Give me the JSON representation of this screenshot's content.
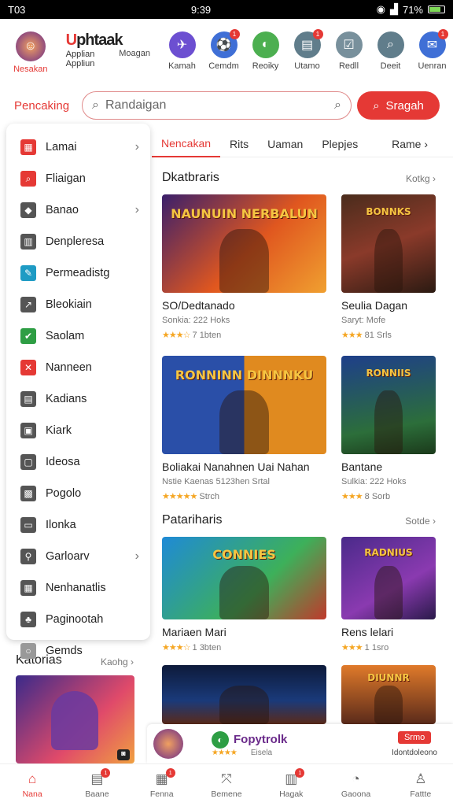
{
  "status": {
    "time_left": "T03",
    "time_center": "9:39",
    "battery": "71%"
  },
  "top_nav": {
    "profile_label": "Nesakan",
    "logo_text_1": "U",
    "logo_text_2": "phtaak",
    "logo_sub_1": "Applian",
    "logo_sub_2": "Appliun",
    "logo_side": "Moagan",
    "items": [
      {
        "label": "Kamah",
        "color": "#6c4fd1",
        "glyph": "✈",
        "badge": ""
      },
      {
        "label": "Cemdm",
        "color": "#3f6fd6",
        "glyph": "⚽",
        "badge": "1"
      },
      {
        "label": "Reoiky",
        "color": "#4caf50",
        "glyph": "◐",
        "badge": ""
      },
      {
        "label": "Utamo",
        "color": "#607d8b",
        "glyph": "▤",
        "badge": "1"
      },
      {
        "label": "Redll",
        "color": "#78909c",
        "glyph": "☑",
        "badge": ""
      },
      {
        "label": "Deeit",
        "color": "#607d8b",
        "glyph": "⌕",
        "badge": ""
      },
      {
        "label": "Uenran",
        "color": "#3f6fd6",
        "glyph": "✉",
        "badge": "1"
      }
    ]
  },
  "search": {
    "label": "Pencaking",
    "placeholder": "Randaigan",
    "button": "Sragah"
  },
  "drawer": [
    {
      "label": "Lamai",
      "color": "#e53935",
      "glyph": "▦",
      "chev": "›"
    },
    {
      "label": "Fliaigan",
      "color": "#e53935",
      "glyph": "⌕",
      "chev": ""
    },
    {
      "label": "Banao",
      "color": "#555",
      "glyph": "◆",
      "chev": "›"
    },
    {
      "label": "Denpleresa",
      "color": "#555",
      "glyph": "▥",
      "chev": ""
    },
    {
      "label": "Permeadistg",
      "color": "#1e9bc4",
      "glyph": "✎",
      "chev": ""
    },
    {
      "label": "Bleokiain",
      "color": "#555",
      "glyph": "↗",
      "chev": ""
    },
    {
      "label": "Saolam",
      "color": "#2e9e44",
      "glyph": "✔",
      "chev": ""
    },
    {
      "label": "Nanneen",
      "color": "#e53935",
      "glyph": "✕",
      "chev": ""
    },
    {
      "label": "Kadians",
      "color": "#555",
      "glyph": "▤",
      "chev": ""
    },
    {
      "label": "Kiark",
      "color": "#555",
      "glyph": "▣",
      "chev": ""
    },
    {
      "label": "Ideosa",
      "color": "#555",
      "glyph": "▢",
      "chev": ""
    },
    {
      "label": "Pogolo",
      "color": "#555",
      "glyph": "▩",
      "chev": ""
    },
    {
      "label": "Ilonka",
      "color": "#555",
      "glyph": "▭",
      "chev": ""
    },
    {
      "label": "Garloarv",
      "color": "#555",
      "glyph": "⚲",
      "chev": "›"
    },
    {
      "label": "Nenhanatlis",
      "color": "#555",
      "glyph": "▦",
      "chev": ""
    },
    {
      "label": "Paginootah",
      "color": "#555",
      "glyph": "♣",
      "chev": ""
    },
    {
      "label": "Gemds",
      "color": "#999",
      "glyph": "○",
      "chev": ""
    }
  ],
  "tabs": {
    "items": [
      "Nencakan",
      "Rits",
      "Uaman",
      "Plepjes"
    ],
    "more": "Rame ›"
  },
  "section1": {
    "title": "Dkatbraris",
    "more": "Kotkg ›"
  },
  "section2": {
    "title": "Patariharis",
    "more": "Sotde ›"
  },
  "cards": [
    {
      "title": "SO/Dedtanado",
      "sub": "Sonkia: 222 Hoks",
      "stars": "★★★☆",
      "rating": "7 1bten",
      "banner": "NAUNUIN NERBALUN",
      "bg": "linear-gradient(135deg,#3a1f6b,#e0571f 55%,#f0a030)"
    },
    {
      "title": "Seulia Dagan",
      "sub": "Saryt: Mofe",
      "stars": "★★★",
      "rating": "81 Srls",
      "banner": "BONNKS",
      "bg": "linear-gradient(160deg,#4a2c1c,#8a3a2a 50%,#2b1a12)"
    },
    {
      "title": "Boliakai Nanahnen Uai Nahan",
      "sub": "Nstie Kaenas 5123hen Srtal",
      "stars": "★★★★★",
      "rating": "Strch",
      "banner": "RONNINN  DINNNKU",
      "bg": "linear-gradient(90deg,#2a4fa8 50%,#e08a1f 50%)"
    },
    {
      "title": "Bantane",
      "sub": "Sulkia: 222 Hoks",
      "stars": "★★★",
      "rating": "8 Sorb",
      "banner": "RONNIIS",
      "bg": "linear-gradient(170deg,#1e3f8a,#2c6e3a 70%,#1b3a1b)"
    },
    {
      "title": "Mariaen Mari",
      "sub": "",
      "stars": "★★★☆",
      "rating": "1 3bten",
      "banner": "CONNIES",
      "bg": "linear-gradient(135deg,#1f8ad6,#3db05a 60%,#c0392b)"
    },
    {
      "title": "Rens lelari",
      "sub": "",
      "stars": "★★★",
      "rating": "1 1sro",
      "banner": "RADNIUS",
      "bg": "linear-gradient(150deg,#4a2a8a,#8a3ab0 60%,#2a1a4a)"
    },
    {
      "title": "",
      "sub": "",
      "stars": "",
      "rating": "",
      "banner": "",
      "bg": "linear-gradient(180deg,#0d1a3a,#1a3a7a 60%,#5a2a1a)"
    },
    {
      "title": "",
      "sub": "",
      "stars": "",
      "rating": "",
      "banner": "DIUNNR",
      "bg": "linear-gradient(180deg,#e07a2a,#5a2a1a)"
    }
  ],
  "left_section": {
    "title": "Katorias",
    "more": "Kaohg ›"
  },
  "popup": {
    "app_name": "Fopytrolk",
    "sub": "Eisela",
    "right_btn": "Srmo",
    "right_text": "Idontdoleono",
    "stars": "★★★★"
  },
  "bottom_nav": [
    {
      "label": "Nana",
      "glyph": "⌂",
      "badge": ""
    },
    {
      "label": "Baane",
      "glyph": "▤",
      "badge": "1"
    },
    {
      "label": "Fenna",
      "glyph": "▦",
      "badge": "1"
    },
    {
      "label": "Bemene",
      "glyph": "⤧",
      "badge": ""
    },
    {
      "label": "Hagak",
      "glyph": "▥",
      "badge": "1"
    },
    {
      "label": "Gaoona",
      "glyph": "◔",
      "badge": ""
    },
    {
      "label": "Fattte",
      "glyph": "♙",
      "badge": ""
    }
  ]
}
